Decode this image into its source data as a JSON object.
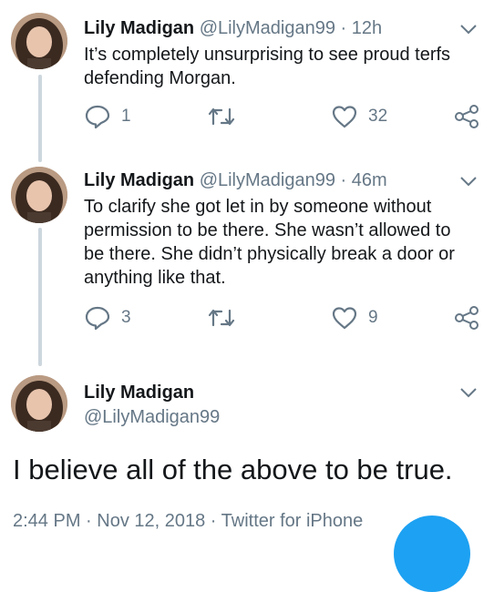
{
  "tweets": [
    {
      "name": "Lily Madigan",
      "handle": "@LilyMadigan99",
      "separator": "·",
      "time": "12h",
      "text_lines": [
        "It’s completely unsurprising to see proud terfs",
        "defending Morgan."
      ],
      "replies": "1",
      "retweets": "",
      "likes": "32"
    },
    {
      "name": "Lily Madigan",
      "handle": "@LilyMadigan99",
      "separator": "·",
      "time": "46m",
      "text_lines": [
        "To clarify she got let in by someone without",
        "permission to be there. She wasn’t allowed to",
        "be there. She didn’t physically break a door or",
        "anything like that."
      ],
      "replies": "3",
      "retweets": "",
      "likes": "9"
    }
  ],
  "main_tweet": {
    "name": "Lily Madigan",
    "handle": "@LilyMadigan99",
    "text": "I believe all of the above to be true.",
    "meta": "2:44 PM · Nov 12, 2018 · Twitter for iPhone"
  },
  "colors": {
    "accent": "#1da1f2",
    "muted": "#657786",
    "thread_line": "#ccd6dd"
  },
  "icons": [
    "reply-icon",
    "retweet-icon",
    "like-icon",
    "share-icon",
    "chevron-down-icon",
    "compose-fab"
  ]
}
